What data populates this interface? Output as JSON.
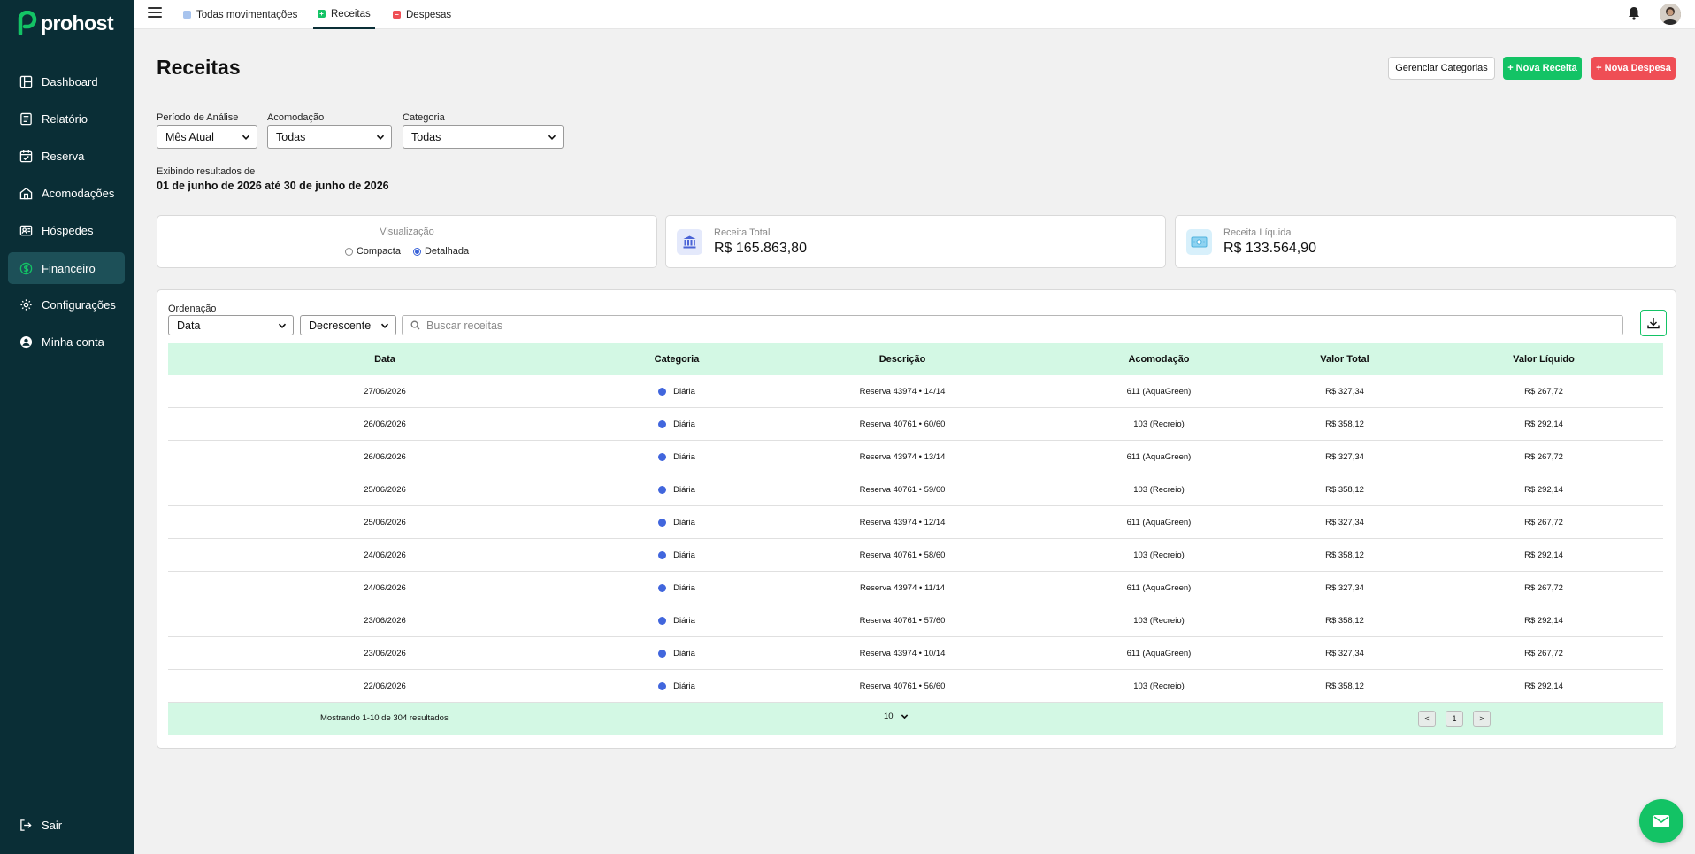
{
  "brand": {
    "name": "prohost",
    "sidebar_color": "#0a2e36",
    "accent": "#13c365"
  },
  "sidebar": {
    "items": [
      {
        "label": "Dashboard",
        "icon": "dashboard-icon"
      },
      {
        "label": "Relatório",
        "icon": "report-icon"
      },
      {
        "label": "Reserva",
        "icon": "calendar-icon"
      },
      {
        "label": "Acomodações",
        "icon": "house-icon"
      },
      {
        "label": "Hóspedes",
        "icon": "id-card-icon"
      },
      {
        "label": "Financeiro",
        "icon": "dollar-icon",
        "active": true
      },
      {
        "label": "Configurações",
        "icon": "gear-icon"
      },
      {
        "label": "Minha conta",
        "icon": "user-icon"
      }
    ],
    "logout": "Sair"
  },
  "topbar": {
    "tabs": [
      {
        "label": "Todas movimentações"
      },
      {
        "label": "Receitas",
        "active": true
      },
      {
        "label": "Despesas"
      }
    ]
  },
  "page": {
    "title": "Receitas",
    "buttons": {
      "manage": "Gerenciar Categorias",
      "new_income": "+ Nova Receita",
      "new_expense": "+ Nova Despesa"
    }
  },
  "filters": {
    "period": {
      "label": "Período de Análise",
      "value": "Mês Atual"
    },
    "accommodation": {
      "label": "Acomodação",
      "value": "Todas"
    },
    "category": {
      "label": "Categoria",
      "value": "Todas"
    }
  },
  "results": {
    "label": "Exibindo resultados de",
    "range": "01 de junho de 2026 até 30 de junho de 2026"
  },
  "visualization": {
    "title": "Visualização",
    "options": [
      "Compacta",
      "Detalhada"
    ],
    "selected": "Detalhada"
  },
  "kpis": {
    "total": {
      "label": "Receita Total",
      "value": "R$ 165.863,80"
    },
    "net": {
      "label": "Receita Líquida",
      "value": "R$ 133.564,90"
    }
  },
  "table": {
    "sort_label": "Ordenação",
    "sort_field": "Data",
    "sort_order": "Decrescente",
    "search_placeholder": "Buscar receitas",
    "columns": [
      "Data",
      "Categoria",
      "Descrição",
      "Acomodação",
      "Valor Total",
      "Valor Líquido"
    ],
    "rows": [
      {
        "date": "27/06/2026",
        "category": "Diária",
        "description": "Reserva 43974 • 14/14",
        "accommodation": "611 (AquaGreen)",
        "total": "R$ 327,34",
        "net": "R$ 267,72"
      },
      {
        "date": "26/06/2026",
        "category": "Diária",
        "description": "Reserva 40761 • 60/60",
        "accommodation": "103 (Recreio)",
        "total": "R$ 358,12",
        "net": "R$ 292,14"
      },
      {
        "date": "26/06/2026",
        "category": "Diária",
        "description": "Reserva 43974 • 13/14",
        "accommodation": "611 (AquaGreen)",
        "total": "R$ 327,34",
        "net": "R$ 267,72"
      },
      {
        "date": "25/06/2026",
        "category": "Diária",
        "description": "Reserva 40761 • 59/60",
        "accommodation": "103 (Recreio)",
        "total": "R$ 358,12",
        "net": "R$ 292,14"
      },
      {
        "date": "25/06/2026",
        "category": "Diária",
        "description": "Reserva 43974 • 12/14",
        "accommodation": "611 (AquaGreen)",
        "total": "R$ 327,34",
        "net": "R$ 267,72"
      },
      {
        "date": "24/06/2026",
        "category": "Diária",
        "description": "Reserva 40761 • 58/60",
        "accommodation": "103 (Recreio)",
        "total": "R$ 358,12",
        "net": "R$ 292,14"
      },
      {
        "date": "24/06/2026",
        "category": "Diária",
        "description": "Reserva 43974 • 11/14",
        "accommodation": "611 (AquaGreen)",
        "total": "R$ 327,34",
        "net": "R$ 267,72"
      },
      {
        "date": "23/06/2026",
        "category": "Diária",
        "description": "Reserva 40761 • 57/60",
        "accommodation": "103 (Recreio)",
        "total": "R$ 358,12",
        "net": "R$ 292,14"
      },
      {
        "date": "23/06/2026",
        "category": "Diária",
        "description": "Reserva 43974 • 10/14",
        "accommodation": "611 (AquaGreen)",
        "total": "R$ 327,34",
        "net": "R$ 267,72"
      },
      {
        "date": "22/06/2026",
        "category": "Diária",
        "description": "Reserva 40761 • 56/60",
        "accommodation": "103 (Recreio)",
        "total": "R$ 358,12",
        "net": "R$ 292,14"
      }
    ],
    "footer": {
      "showing": "Mostrando 1-10 de 304 resultados",
      "page_size": "10",
      "prev": "<",
      "page": "1",
      "next": ">"
    }
  }
}
